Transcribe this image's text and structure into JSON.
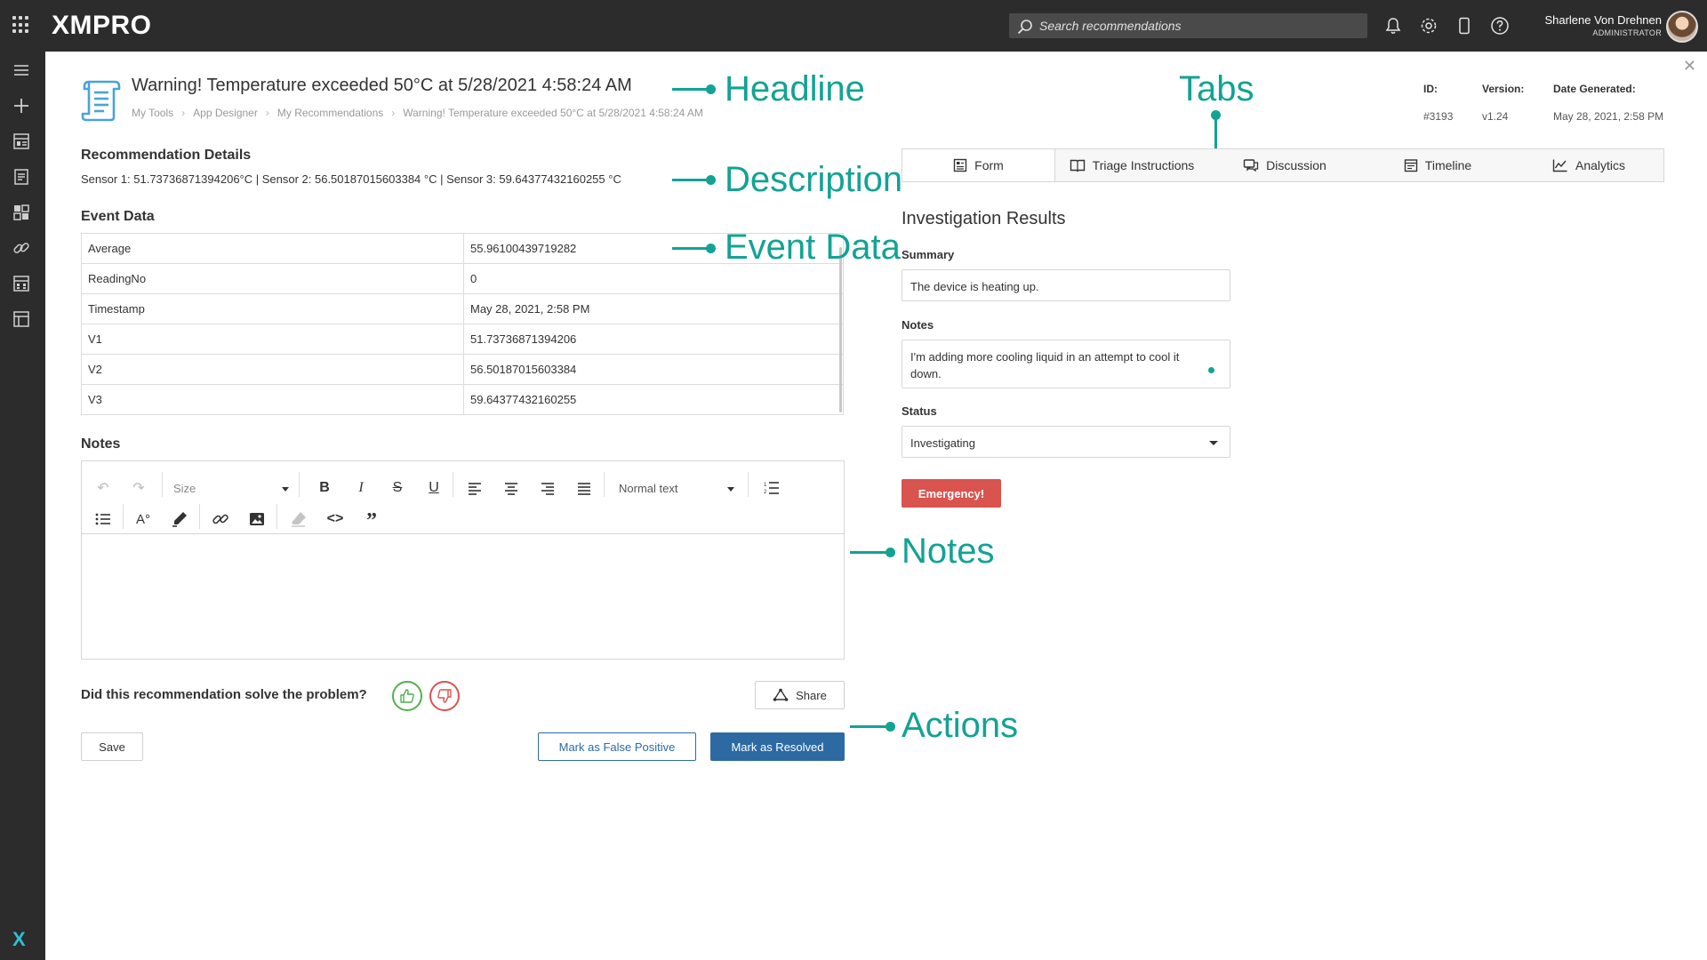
{
  "app": {
    "logo": "XMPRO",
    "search_placeholder": "Search recommendations",
    "user_name": "Sharlene Von Drehnen",
    "user_role": "ADMINISTRATOR"
  },
  "header": {
    "headline": "Warning! Temperature exceeded 50°C at 5/28/2021 4:58:24 AM",
    "breadcrumb": [
      "My Tools",
      "App Designer",
      "My Recommendations",
      "Warning! Temperature exceeded 50°C at 5/28/2021 4:58:24 AM"
    ],
    "meta": {
      "id_label": "ID:",
      "id_value": "#3193",
      "version_label": "Version:",
      "version_value": "v1.24",
      "date_label": "Date Generated:",
      "date_value": "May 28, 2021, 2:58 PM"
    }
  },
  "details": {
    "title": "Recommendation Details",
    "description": "Sensor 1: 51.73736871394206°C | Sensor 2: 56.50187015603384 °C | Sensor 3: 59.64377432160255 °C"
  },
  "event_data": {
    "title": "Event Data",
    "rows": [
      {
        "key": "Average",
        "value": "55.96100439719282"
      },
      {
        "key": "ReadingNo",
        "value": "0"
      },
      {
        "key": "Timestamp",
        "value": "May 28, 2021, 2:58 PM"
      },
      {
        "key": "V1",
        "value": "51.73736871394206"
      },
      {
        "key": "V2",
        "value": "56.50187015603384"
      },
      {
        "key": "V3",
        "value": "59.64377432160255"
      }
    ]
  },
  "notes_editor": {
    "title": "Notes",
    "size_label": "Size",
    "style_label": "Normal text"
  },
  "feedback": {
    "question": "Did this recommendation solve the problem?",
    "share_label": "Share"
  },
  "actions": {
    "save_label": "Save",
    "false_positive_label": "Mark as False Positive",
    "resolved_label": "Mark as Resolved"
  },
  "tabs": [
    {
      "label": "Form",
      "icon": "form-icon",
      "active": true
    },
    {
      "label": "Triage Instructions",
      "icon": "book-icon"
    },
    {
      "label": "Discussion",
      "icon": "chat-icon"
    },
    {
      "label": "Timeline",
      "icon": "timeline-icon"
    },
    {
      "label": "Analytics",
      "icon": "chart-icon"
    }
  ],
  "form": {
    "title": "Investigation Results",
    "summary_label": "Summary",
    "summary_value": "The device is heating up.",
    "notes_label": "Notes",
    "notes_value": "I'm adding more cooling liquid in an attempt to cool it down.",
    "status_label": "Status",
    "status_value": "Investigating",
    "emergency_label": "Emergency!"
  },
  "annotations": {
    "headline": "Headline",
    "tabs": "Tabs",
    "description": "Description",
    "event_data": "Event Data",
    "notes": "Notes",
    "actions": "Actions"
  },
  "colors": {
    "annotation": "#12a393",
    "primary": "#2d6aa3",
    "danger": "#d9534f",
    "topbar": "#2c2c2c"
  }
}
